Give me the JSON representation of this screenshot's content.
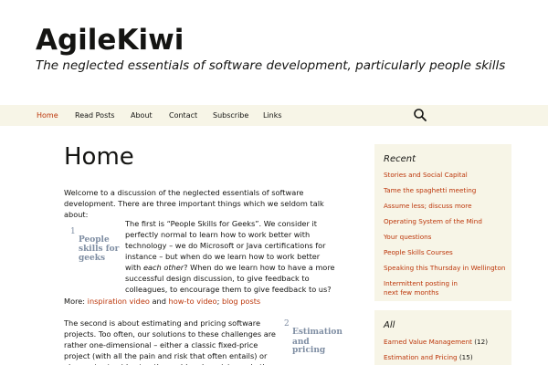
{
  "header": {
    "site_title": "AgileKiwi",
    "tagline": "The neglected essentials of software development, particularly people skills"
  },
  "nav": {
    "items": [
      "Home",
      "Read Posts",
      "About",
      "Contact",
      "Subscribe",
      "Links"
    ],
    "active": "Home",
    "search_icon": "search-icon"
  },
  "main": {
    "title": "Home",
    "intro": "Welcome to a discussion of the neglected essentials of software development.  There are three important things which we seldom talk about:",
    "inset1": {
      "num": "1",
      "label_lines": [
        "People",
        "skills for",
        "geeks"
      ]
    },
    "para1_a": "The first is “People Skills for Geeks”.  We consider it perfectly normal to learn how to work better with technology – we do Microsoft or Java certifications for instance – but when do we learn how to work better with ",
    "para1_em": "each other",
    "para1_b": "?  When do we learn how to have a more successful design discussion, to give feedback to colleagues, to encourage them to give feedback to us?",
    "more_label": "More: ",
    "more_link1": "inspiration video",
    "more_and": " and ",
    "more_link2": "how-to video",
    "more_sep": ";   ",
    "more_link3": "blog posts",
    "inset2": {
      "num": "2",
      "label_lines": [
        "Estimation",
        "and",
        "pricing"
      ]
    },
    "para2": "The second is about estimating and pricing software projects.  Too often, our solutions to these challenges are rather one-dimensional – either a classic fixed-price project (with all the pain and risk that often entails) or else we try to side-step the problem by pricing only the next iteration.  We"
  },
  "sidebar": {
    "recent_title": "Recent",
    "recent_items": [
      "Stories and Social Capital",
      "Tame the spaghetti meeting",
      "Assume less; discuss more",
      "Operating System of the Mind",
      "Your questions",
      "People Skills Courses",
      "Speaking this Thursday in Wellington",
      "Intermittent posting in next few months"
    ],
    "all_title": "All",
    "all_items": [
      {
        "label": "Earned Value Management",
        "count": " (12)"
      },
      {
        "label": "Estimation and Pricing",
        "count": " (15)"
      }
    ]
  },
  "colors": {
    "accent": "#bc360a",
    "nav_bg": "#f7f5e7",
    "widget_bg": "#f7f5e7",
    "inset_text": "#7f8ea3"
  }
}
